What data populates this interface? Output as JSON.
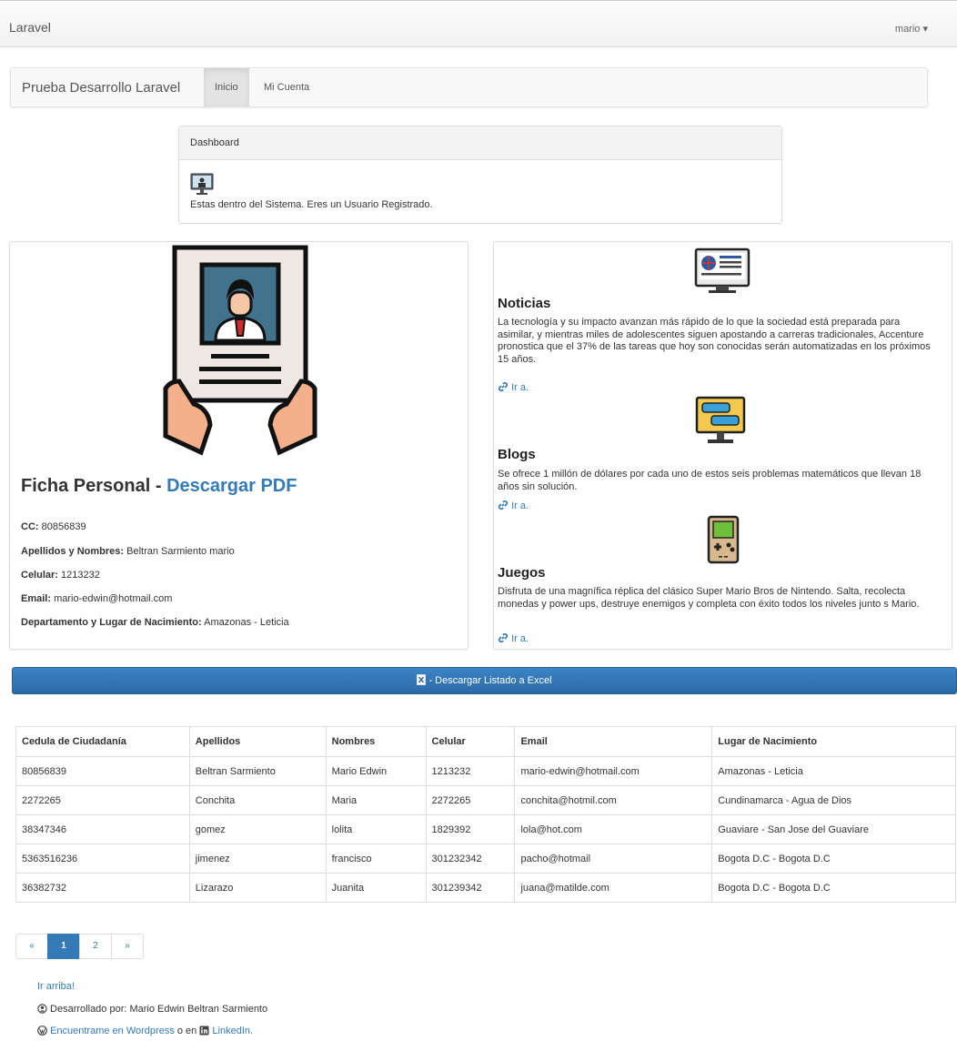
{
  "topbar": {
    "brand": "Laravel",
    "user": "mario ▾"
  },
  "nav": {
    "brand": "Prueba Desarrollo Laravel",
    "tabs": [
      {
        "label": "Inicio"
      },
      {
        "label": "Mi Cuenta"
      }
    ]
  },
  "dashboard": {
    "title": "Dashboard",
    "message": "Estas dentro del Sistema. Eres un Usuario Registrado."
  },
  "ficha": {
    "title": "Ficha Personal - ",
    "pdf_link": "Descargar PDF",
    "cc_label": "CC:",
    "cc": " 80856839",
    "names_label": "Apellidos y Nombres:",
    "names": " Beltran Sarmiento mario",
    "cel_label": "Celular:",
    "cel": " 1213232",
    "email_label": "Email:",
    "email": " mario-edwin@hotmail.com",
    "birth_label": "Departamento y Lugar de Nacimiento:",
    "birth": " Amazonas - Leticia"
  },
  "news": [
    {
      "title": "Noticias",
      "text": "La tecnología y su impacto avanzan más rápido de lo que la sociedad está preparada para asimilar, y mientras miles de adolescentes siguen apostando a carreras tradicionales, Accenture pronostica que el 37% de las tareas que hoy son conocidas serán automatizadas en los próximos 15 años.",
      "link": "Ir a."
    },
    {
      "title": "Blogs",
      "text": "Se ofrece 1 millón de dólares por cada uno de estos seis problemas matemáticos que llevan 18 años sin solución.",
      "link": "Ir a."
    },
    {
      "title": "Juegos",
      "text": "Disfruta de una magnífica réplica del clásico Super Mario Bros de Nintendo. Salta, recolecta monedas y power ups, destruye enemigos y completa con éxito todos los niveles junto s Mario.",
      "link": "Ir a."
    }
  ],
  "excel_button": " - Descargar Listado a Excel",
  "table": {
    "headers": [
      "Cedula de Ciudadanía",
      "Apellidos",
      "Nombres",
      "Celular",
      "Email",
      "Lugar de Nacimiento"
    ],
    "rows": [
      [
        "80856839",
        "Beltran Sarmiento",
        "Mario Edwin",
        "1213232",
        "mario-edwin@hotmail.com",
        "Amazonas - Leticia"
      ],
      [
        "2272265",
        "Conchita",
        "Maria",
        "2272265",
        "conchita@hotmil.com",
        "Cundinamarca - Agua de Dios"
      ],
      [
        "38347346",
        "gomez",
        "lolita",
        "1829392",
        "lola@hot.com",
        "Guaviare - San Jose del Guaviare"
      ],
      [
        "5363516236",
        "jimenez",
        "francisco",
        "301232342",
        "pacho@hotmail",
        "Bogota D.C - Bogota D.C"
      ],
      [
        "36382732",
        "Lizarazo",
        "Juanita",
        "301239342",
        "juana@matilde.com",
        "Bogota D.C - Bogota D.C"
      ]
    ]
  },
  "pagination": {
    "prev": "«",
    "pages": [
      "1",
      "2"
    ],
    "next": "»"
  },
  "footer": {
    "top_link": "Ir arriba!",
    "dev_text": " Desarrollado por: Mario Edwin Beltran Sarmiento",
    "wp_link": "Encuentrame en Wordpress",
    "or_text": " o en ",
    "li_link": "LinkedIn."
  },
  "colors": {
    "link": "#337ab7",
    "excel": "#2f70ae"
  }
}
